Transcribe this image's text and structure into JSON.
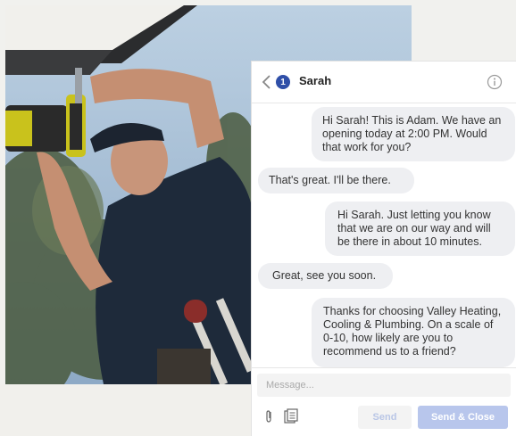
{
  "photo": {
    "alt_subject": "technician-on-ladder"
  },
  "chat": {
    "unread_count": "1",
    "contact_name": "Sarah",
    "messages": [
      {
        "direction": "outgoing",
        "text": "Hi Sarah! This is Adam. We have an opening today at 2:00 PM. Would that work for you?"
      },
      {
        "direction": "incoming",
        "text": "That's great. I'll be there."
      },
      {
        "direction": "outgoing",
        "text": "Hi Sarah. Just letting you know that we are on our way and will be there in about 10 minutes."
      },
      {
        "direction": "incoming",
        "text": "Great, see you soon."
      },
      {
        "direction": "outgoing",
        "text": "Thanks for choosing Valley Heating, Cooling & Plumbing. On a scale of 0-10, how likely are you to recommend us to a friend?"
      }
    ],
    "composer": {
      "placeholder": "Message...",
      "send_label": "Send",
      "send_close_label": "Send & Close"
    }
  },
  "colors": {
    "accent": "#2f4fa8",
    "bubble": "#eeeff2",
    "send_close_bg": "#b8c6ec"
  }
}
